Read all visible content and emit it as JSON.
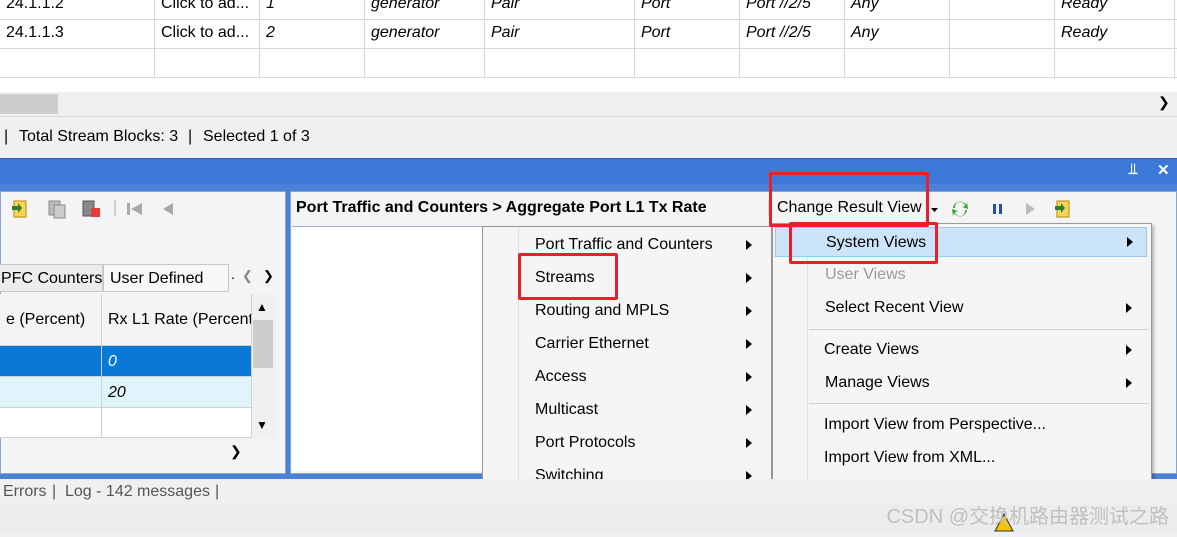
{
  "top_grid": {
    "rows": [
      {
        "id": "24.1.1.2",
        "name": "Click to ad...",
        "num": "1",
        "type": "generator",
        "mode": "Pair",
        "kind": "Port",
        "port": "Port //2/5",
        "match": "Any",
        "status": "Ready"
      },
      {
        "id": "24.1.1.3",
        "name": "Click to ad...",
        "num": "2",
        "type": "generator",
        "mode": "Pair",
        "kind": "Port",
        "port": "Port //2/5",
        "match": "Any",
        "status": "Ready"
      }
    ]
  },
  "status": {
    "total": "Total Stream Blocks: 3",
    "selected": "Selected 1 of 3"
  },
  "titlebar": {
    "pin_icon": "pin-icon",
    "close_icon": "close-icon"
  },
  "left_panel": {
    "tabs": [
      "PFC Counters",
      "User Defined"
    ],
    "columns": [
      "e (Percent)",
      "Rx L1 Rate (Percent"
    ],
    "rows": [
      {
        "c1": "",
        "c2": "0"
      },
      {
        "c1": "",
        "c2": "20"
      }
    ]
  },
  "right_panel": {
    "breadcrumb": "Port Traffic and Counters > Aggregate Port L1 Tx Rate",
    "change_view": "Change Result View"
  },
  "menu1": {
    "items": [
      "Port Traffic and Counters",
      "Streams",
      "Routing and MPLS",
      "Carrier Ethernet",
      "Access",
      "Multicast",
      "Port Protocols",
      "Switching"
    ]
  },
  "menu2": {
    "system_views": "System Views",
    "user_views": "User Views",
    "select_recent": "Select Recent View",
    "create_views": "Create Views",
    "manage_views": "Manage Views",
    "import_perspective": "Import View from Perspective...",
    "import_xml": "Import View from XML..."
  },
  "bottom_status": {
    "errors": "Errors",
    "log": "Log - 142 messages"
  },
  "watermark": "CSDN @交换机路由器测试之路",
  "colors": {
    "highlight_red": "#e8202a",
    "title_blue": "#3c78d8",
    "selection_blue": "#0a78d7",
    "selected_row_light": "#dff4fb"
  }
}
